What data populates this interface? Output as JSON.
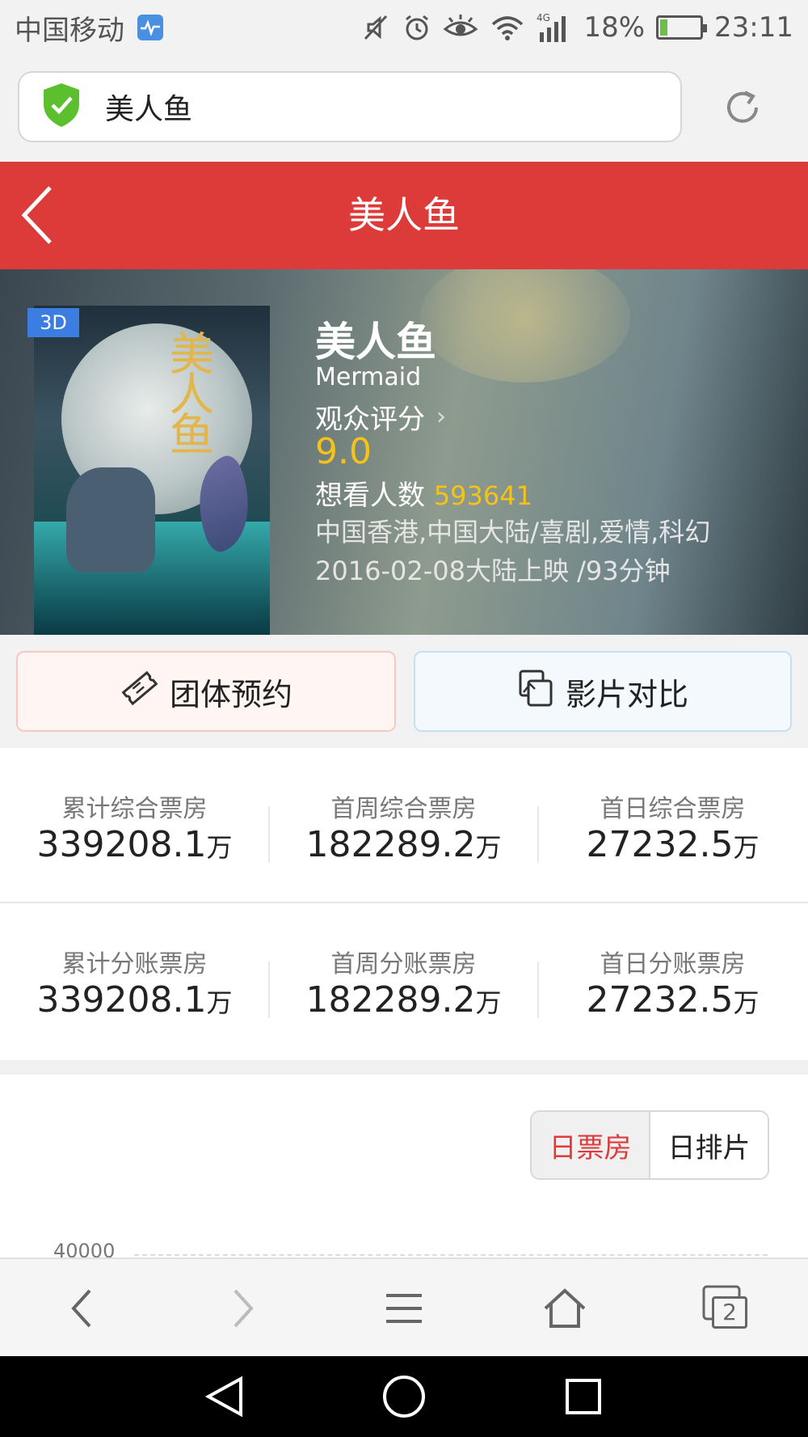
{
  "status_bar": {
    "carrier": "中国移动",
    "network": "4G",
    "battery_percent": "18%",
    "battery_level": 0.18,
    "time": "23:11"
  },
  "url_bar": {
    "text": "美人鱼"
  },
  "header": {
    "title": "美人鱼"
  },
  "movie": {
    "badge": "3D",
    "title": "美人鱼",
    "english_title": "Mermaid",
    "rating_label": "观众评分",
    "rating": "9.0",
    "want_label": "想看人数",
    "want_count": "593641",
    "genre": "中国香港,中国大陆/喜剧,爱情,科幻",
    "release": "2016-02-08大陆上映 /93分钟"
  },
  "actions": {
    "group_booking": "团体预约",
    "compare": "影片对比"
  },
  "stats_row1": [
    {
      "label": "累计综合票房",
      "value": "339208.1",
      "unit": "万"
    },
    {
      "label": "首周综合票房",
      "value": "182289.2",
      "unit": "万"
    },
    {
      "label": "首日综合票房",
      "value": "27232.5",
      "unit": "万"
    }
  ],
  "stats_row2": [
    {
      "label": "累计分账票房",
      "value": "339208.1",
      "unit": "万"
    },
    {
      "label": "首周分账票房",
      "value": "182289.2",
      "unit": "万"
    },
    {
      "label": "首日分账票房",
      "value": "27232.5",
      "unit": "万"
    }
  ],
  "chart": {
    "tabs": [
      "日票房",
      "日排片"
    ],
    "active_tab": "日票房",
    "top_tick": "40000"
  },
  "colors": {
    "header_red": "#dc3b3a",
    "rating_yellow": "#f5c21a",
    "active_tab_red": "#e03a3a",
    "shield_green": "#5cc02e"
  },
  "icons": {
    "status": [
      "health-icon",
      "mute-icon",
      "alarm-icon",
      "eye-icon",
      "wifi-icon",
      "signal-icon",
      "battery-icon"
    ],
    "browser_bar": [
      "back-icon",
      "forward-icon",
      "menu-icon",
      "home-icon",
      "tabs-icon"
    ],
    "nav_bar": [
      "nav-back-icon",
      "nav-home-icon",
      "nav-recents-icon"
    ]
  },
  "browser_bar": {
    "tab_count": "2"
  }
}
